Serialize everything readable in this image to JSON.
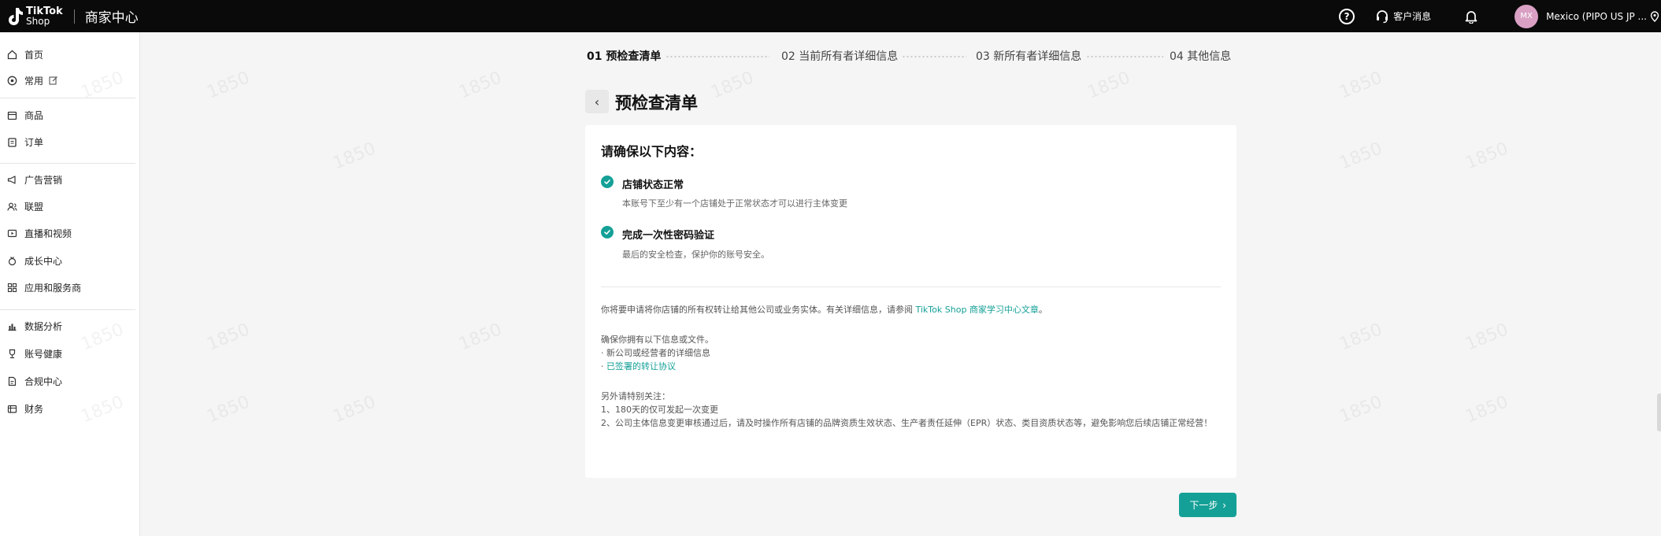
{
  "topbar": {
    "logo_line1": "TikTok",
    "logo_line2": "Shop",
    "title": "商家中心",
    "help_glyph": "?",
    "customer_service": "客户消息",
    "avatar_initials": "MX",
    "account": "Mexico  (PIPO US JP ..."
  },
  "sidebar": {
    "items": [
      {
        "label": "首页",
        "icon": "home-icon"
      },
      {
        "label": "常用",
        "icon": "star-icon"
      },
      {
        "label": "商品",
        "icon": "box-icon"
      },
      {
        "label": "订单",
        "icon": "clipboard-icon"
      },
      {
        "label": "广告营销",
        "icon": "megaphone-icon"
      },
      {
        "label": "联盟",
        "icon": "people-icon"
      },
      {
        "label": "直播和视频",
        "icon": "video-icon"
      },
      {
        "label": "成长中心",
        "icon": "medal-icon"
      },
      {
        "label": "应用和服务商",
        "icon": "apps-icon"
      },
      {
        "label": "数据分析",
        "icon": "chart-icon"
      },
      {
        "label": "账号健康",
        "icon": "trophy-icon"
      },
      {
        "label": "合规中心",
        "icon": "document-icon"
      },
      {
        "label": "财务",
        "icon": "wallet-icon"
      }
    ]
  },
  "watermark": "1850",
  "steps": [
    {
      "label": "01 预检查清单",
      "active": true
    },
    {
      "label": "02 当前所有者详细信息",
      "active": false
    },
    {
      "label": "03 新所有者详细信息",
      "active": false
    },
    {
      "label": "04 其他信息",
      "active": false
    }
  ],
  "page": {
    "back_glyph": "‹",
    "title": "预检查清单"
  },
  "card": {
    "heading": "请确保以下内容：",
    "checks": [
      {
        "title": "店铺状态正常",
        "desc": "本账号下至少有一个店铺处于正常状态才可以进行主体变更"
      },
      {
        "title": "完成一次性密码验证",
        "desc": "最后的安全检查，保护你的账号安全。"
      }
    ],
    "intro_text": "你将要申请将你店铺的所有权转让给其他公司或业务实体。有关详细信息，请参阅 ",
    "intro_link": "TikTok Shop 商家学习中心文章",
    "intro_end": "。",
    "ensure_heading": "确保你拥有以下信息或文件。",
    "ensure_item1": "· 新公司或经营者的详细信息",
    "ensure_item2_prefix": "· ",
    "ensure_item2_link": "已签署的转让协议",
    "note_heading": "另外请特别关注：",
    "note1": "1、180天的仅可发起一次变更",
    "note2": "2、公司主体信息变更审核通过后，请及时操作所有店铺的品牌资质生效状态、生产者责任延伸（EPR）状态、类目资质状态等，避免影响您后续店铺正常经营！"
  },
  "next_button": {
    "label": "下一步",
    "chevron": "›"
  },
  "colors": {
    "accent": "#14a097",
    "topbar": "#0a0a0a",
    "background": "#f5f5f5"
  }
}
